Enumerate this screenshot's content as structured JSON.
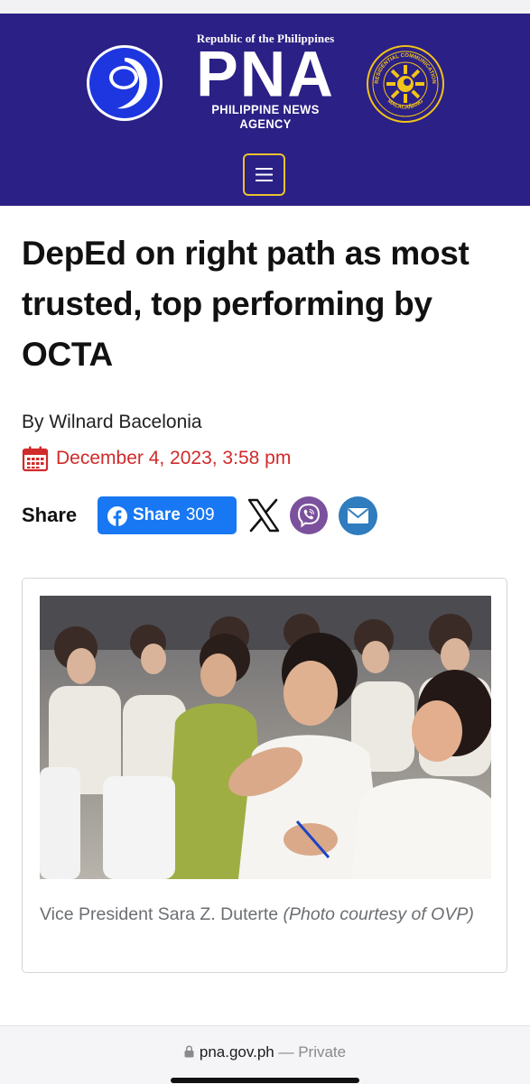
{
  "header": {
    "republic": "Republic of the Philippines",
    "brand": "PNA",
    "agency": "PHILIPPINE NEWS AGENCY",
    "seal_top": "PRESIDENTIAL COMMUNICATIONS",
    "seal_bottom": "MALACAÑANG",
    "colors": {
      "background": "#2b2085",
      "menu_border": "#e8c430",
      "seal_yellow": "#f2c318"
    }
  },
  "article": {
    "title": "DepEd on right path as most trusted, top performing by OCTA",
    "byline": "By Wilnard Bacelonia",
    "date": "December 4, 2023, 3:58 pm",
    "date_color": "#d12a2a"
  },
  "share": {
    "label": "Share",
    "facebook_label": "Share",
    "facebook_count": "309",
    "icons": [
      "facebook-icon",
      "x-icon",
      "viber-icon",
      "mail-icon"
    ]
  },
  "photo": {
    "caption_main": "Vice President Sara Z. Duterte ",
    "caption_credit": "(Photo courtesy of OVP)"
  },
  "browser": {
    "url": "pna.gov.ph",
    "separator": " — ",
    "mode": "Private"
  }
}
